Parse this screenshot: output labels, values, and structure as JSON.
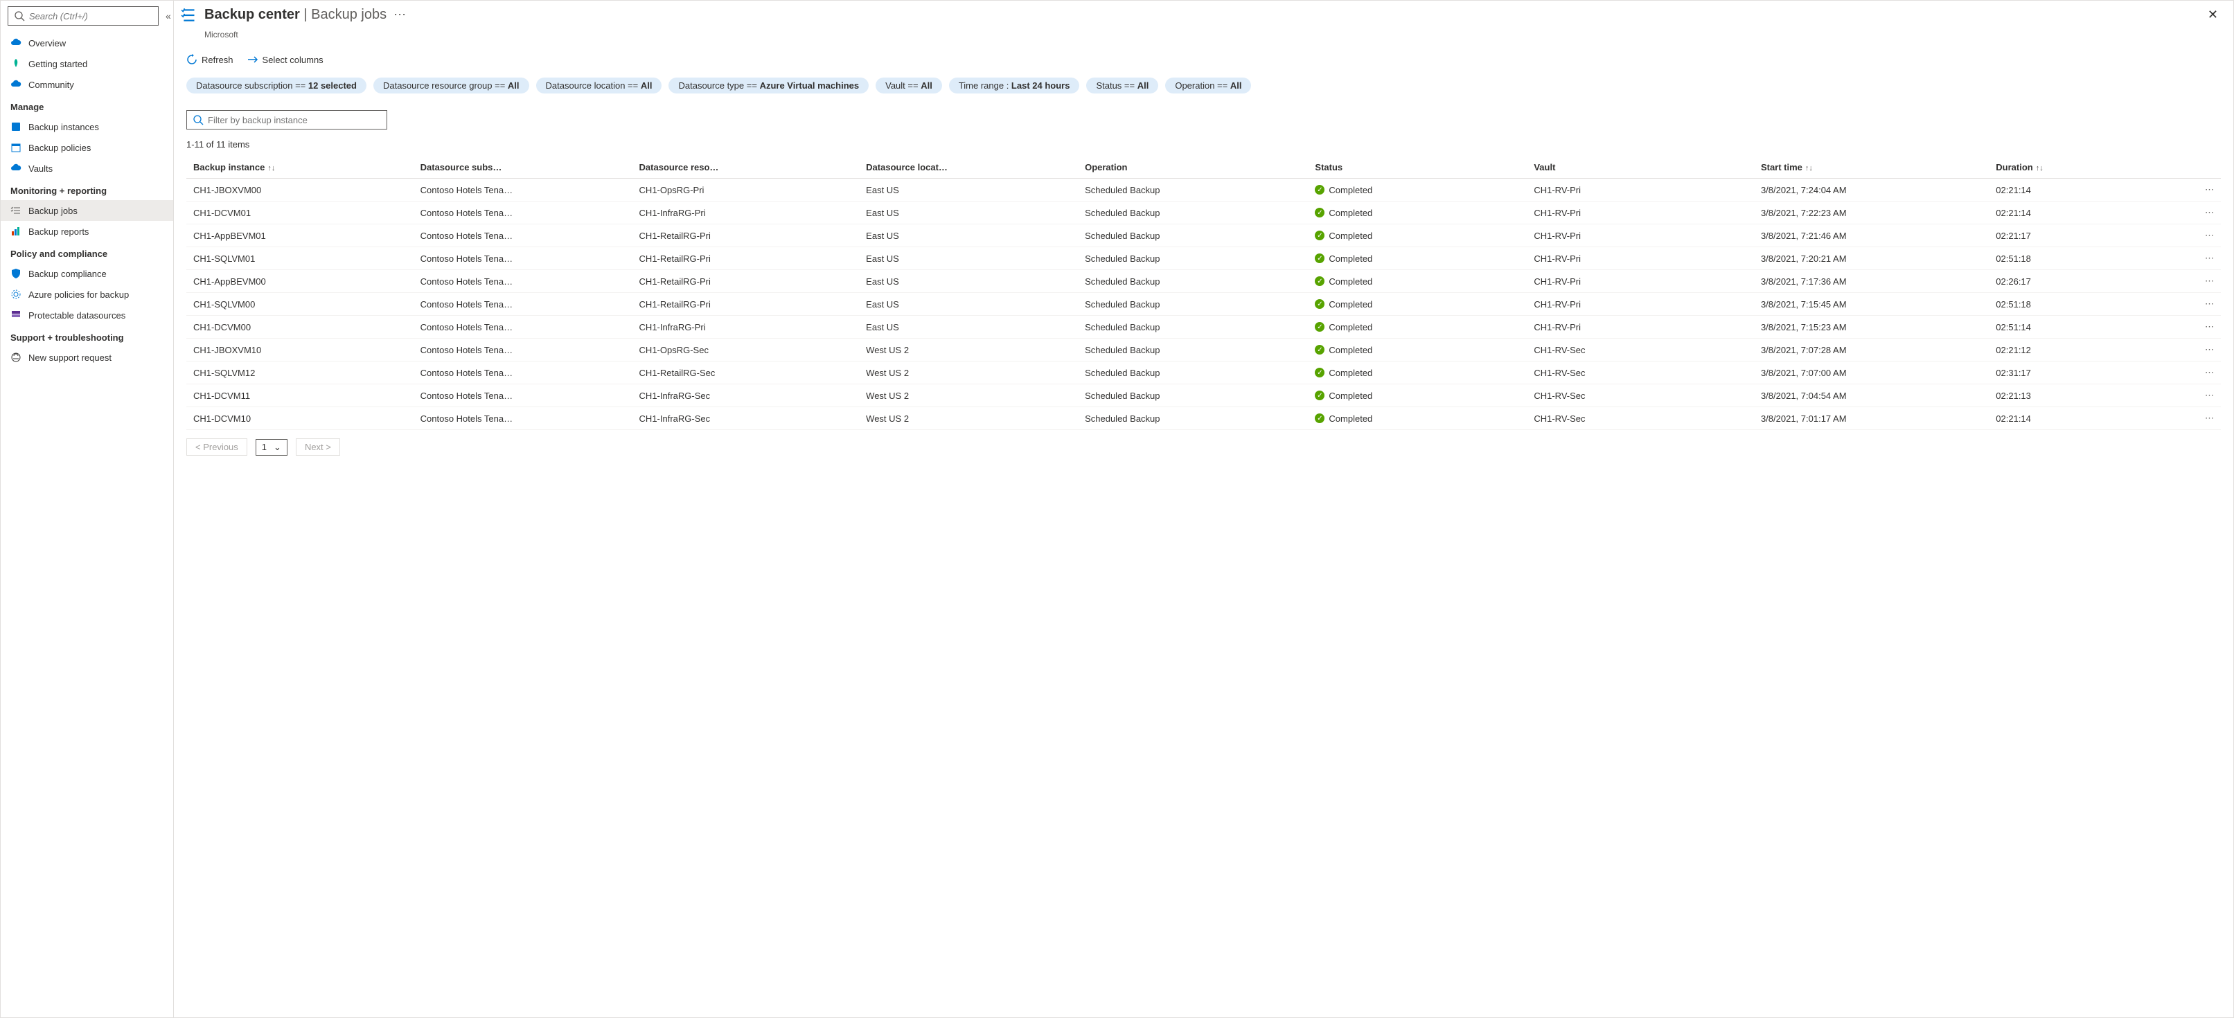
{
  "header": {
    "title": "Backup center",
    "subtitle": "Backup jobs",
    "subtext": "Microsoft"
  },
  "sidebar": {
    "search_placeholder": "Search (Ctrl+/)",
    "groups": [
      {
        "items": [
          {
            "id": "overview",
            "label": "Overview",
            "icon": "cloud-blue"
          },
          {
            "id": "getting-started",
            "label": "Getting started",
            "icon": "rocket"
          },
          {
            "id": "community",
            "label": "Community",
            "icon": "cloud-blue"
          }
        ]
      },
      {
        "title": "Manage",
        "items": [
          {
            "id": "backup-instances",
            "label": "Backup instances",
            "icon": "square-blue"
          },
          {
            "id": "backup-policies",
            "label": "Backup policies",
            "icon": "calendar"
          },
          {
            "id": "vaults",
            "label": "Vaults",
            "icon": "cloud-blue"
          }
        ]
      },
      {
        "title": "Monitoring + reporting",
        "items": [
          {
            "id": "backup-jobs",
            "label": "Backup jobs",
            "icon": "checklist",
            "active": true
          },
          {
            "id": "backup-reports",
            "label": "Backup reports",
            "icon": "chart"
          }
        ]
      },
      {
        "title": "Policy and compliance",
        "items": [
          {
            "id": "backup-compliance",
            "label": "Backup compliance",
            "icon": "shield"
          },
          {
            "id": "azure-policies",
            "label": "Azure policies for backup",
            "icon": "gear-cloud"
          },
          {
            "id": "protectable",
            "label": "Protectable datasources",
            "icon": "stack"
          }
        ]
      },
      {
        "title": "Support + troubleshooting",
        "items": [
          {
            "id": "new-support",
            "label": "New support request",
            "icon": "support"
          }
        ]
      }
    ]
  },
  "toolbar": {
    "refresh": "Refresh",
    "select_columns": "Select columns"
  },
  "filters": [
    {
      "label": "Datasource subscription == ",
      "value": "12 selected"
    },
    {
      "label": "Datasource resource group == ",
      "value": "All"
    },
    {
      "label": "Datasource location == ",
      "value": "All"
    },
    {
      "label": "Datasource type == ",
      "value": "Azure Virtual machines"
    },
    {
      "label": "Vault == ",
      "value": "All"
    },
    {
      "label": "Time range : ",
      "value": "Last 24 hours"
    },
    {
      "label": "Status == ",
      "value": "All"
    },
    {
      "label": "Operation == ",
      "value": "All"
    }
  ],
  "instance_filter_placeholder": "Filter by backup instance",
  "count_text": "1-11 of 11 items",
  "columns": {
    "instance": "Backup instance",
    "subscription": "Datasource subs…",
    "rg": "Datasource reso…",
    "location": "Datasource locat…",
    "operation": "Operation",
    "status": "Status",
    "vault": "Vault",
    "start": "Start time",
    "duration": "Duration"
  },
  "rows": [
    {
      "instance": "CH1-JBOXVM00",
      "subscription": "Contoso Hotels Tena…",
      "rg": "CH1-OpsRG-Pri",
      "location": "East US",
      "operation": "Scheduled Backup",
      "status": "Completed",
      "vault": "CH1-RV-Pri",
      "start": "3/8/2021, 7:24:04 AM",
      "duration": "02:21:14"
    },
    {
      "instance": "CH1-DCVM01",
      "subscription": "Contoso Hotels Tena…",
      "rg": "CH1-InfraRG-Pri",
      "location": "East US",
      "operation": "Scheduled Backup",
      "status": "Completed",
      "vault": "CH1-RV-Pri",
      "start": "3/8/2021, 7:22:23 AM",
      "duration": "02:21:14"
    },
    {
      "instance": "CH1-AppBEVM01",
      "subscription": "Contoso Hotels Tena…",
      "rg": "CH1-RetailRG-Pri",
      "location": "East US",
      "operation": "Scheduled Backup",
      "status": "Completed",
      "vault": "CH1-RV-Pri",
      "start": "3/8/2021, 7:21:46 AM",
      "duration": "02:21:17"
    },
    {
      "instance": "CH1-SQLVM01",
      "subscription": "Contoso Hotels Tena…",
      "rg": "CH1-RetailRG-Pri",
      "location": "East US",
      "operation": "Scheduled Backup",
      "status": "Completed",
      "vault": "CH1-RV-Pri",
      "start": "3/8/2021, 7:20:21 AM",
      "duration": "02:51:18"
    },
    {
      "instance": "CH1-AppBEVM00",
      "subscription": "Contoso Hotels Tena…",
      "rg": "CH1-RetailRG-Pri",
      "location": "East US",
      "operation": "Scheduled Backup",
      "status": "Completed",
      "vault": "CH1-RV-Pri",
      "start": "3/8/2021, 7:17:36 AM",
      "duration": "02:26:17"
    },
    {
      "instance": "CH1-SQLVM00",
      "subscription": "Contoso Hotels Tena…",
      "rg": "CH1-RetailRG-Pri",
      "location": "East US",
      "operation": "Scheduled Backup",
      "status": "Completed",
      "vault": "CH1-RV-Pri",
      "start": "3/8/2021, 7:15:45 AM",
      "duration": "02:51:18"
    },
    {
      "instance": "CH1-DCVM00",
      "subscription": "Contoso Hotels Tena…",
      "rg": "CH1-InfraRG-Pri",
      "location": "East US",
      "operation": "Scheduled Backup",
      "status": "Completed",
      "vault": "CH1-RV-Pri",
      "start": "3/8/2021, 7:15:23 AM",
      "duration": "02:51:14"
    },
    {
      "instance": "CH1-JBOXVM10",
      "subscription": "Contoso Hotels Tena…",
      "rg": "CH1-OpsRG-Sec",
      "location": "West US 2",
      "operation": "Scheduled Backup",
      "status": "Completed",
      "vault": "CH1-RV-Sec",
      "start": "3/8/2021, 7:07:28 AM",
      "duration": "02:21:12"
    },
    {
      "instance": "CH1-SQLVM12",
      "subscription": "Contoso Hotels Tena…",
      "rg": "CH1-RetailRG-Sec",
      "location": "West US 2",
      "operation": "Scheduled Backup",
      "status": "Completed",
      "vault": "CH1-RV-Sec",
      "start": "3/8/2021, 7:07:00 AM",
      "duration": "02:31:17"
    },
    {
      "instance": "CH1-DCVM11",
      "subscription": "Contoso Hotels Tena…",
      "rg": "CH1-InfraRG-Sec",
      "location": "West US 2",
      "operation": "Scheduled Backup",
      "status": "Completed",
      "vault": "CH1-RV-Sec",
      "start": "3/8/2021, 7:04:54 AM",
      "duration": "02:21:13"
    },
    {
      "instance": "CH1-DCVM10",
      "subscription": "Contoso Hotels Tena…",
      "rg": "CH1-InfraRG-Sec",
      "location": "West US 2",
      "operation": "Scheduled Backup",
      "status": "Completed",
      "vault": "CH1-RV-Sec",
      "start": "3/8/2021, 7:01:17 AM",
      "duration": "02:21:14"
    }
  ],
  "pager": {
    "previous": "< Previous",
    "page": "1",
    "next": "Next >"
  }
}
